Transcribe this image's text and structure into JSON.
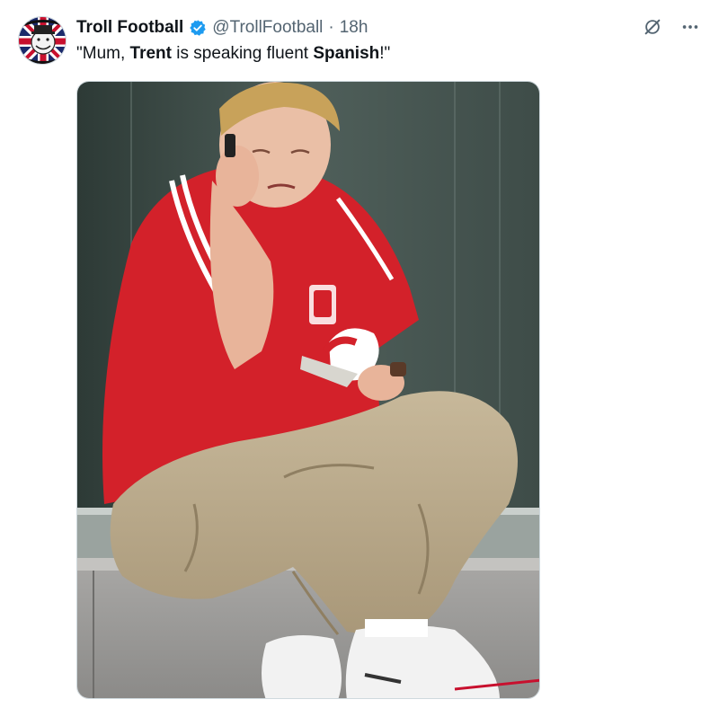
{
  "account": {
    "display_name": "Troll Football",
    "handle": "@TrollFootball",
    "separator": "·",
    "timestamp": "18h",
    "verified": true,
    "verified_color": "#1d9bf0",
    "avatar_icon": "troll-face-union-jack-avatar"
  },
  "tweet": {
    "text_parts": [
      {
        "text": "\"Mum, ",
        "bold": false
      },
      {
        "text": "Trent",
        "bold": true
      },
      {
        "text": " is speaking fluent ",
        "bold": false
      },
      {
        "text": "Spanish",
        "bold": true
      },
      {
        "text": "!\"",
        "bold": false
      }
    ]
  },
  "actions": {
    "grok_icon": "grok-slash-icon",
    "more_icon": "more-dots-icon"
  },
  "media": {
    "photo_icon": "crying-liverpool-fan-photo"
  },
  "colors": {
    "text_primary": "#0f1419",
    "text_secondary": "#536471",
    "jersey_red": "#d3212a"
  }
}
